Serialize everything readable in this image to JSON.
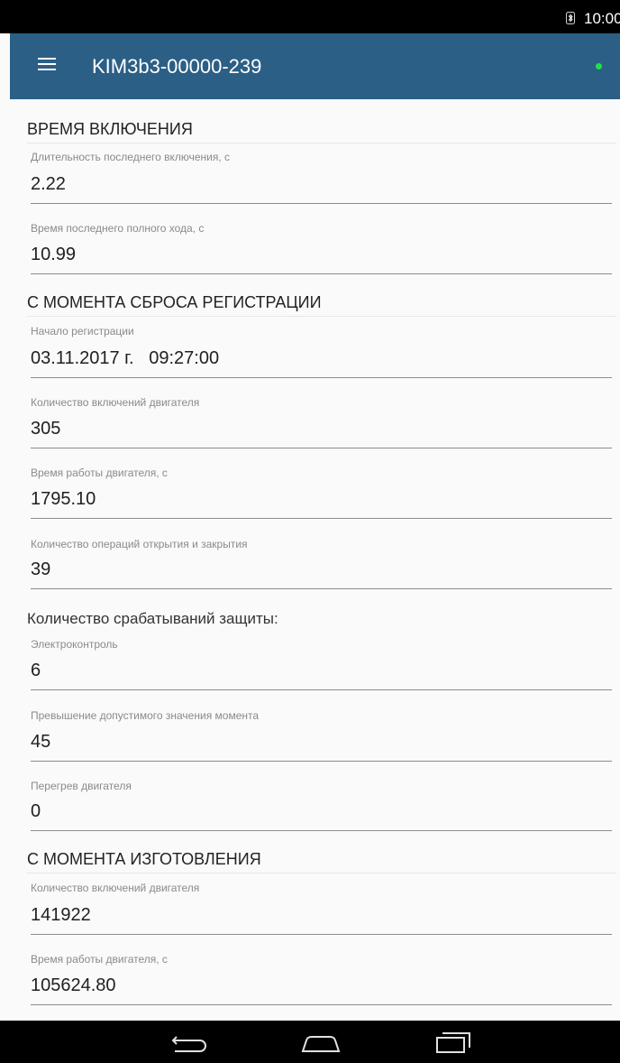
{
  "status_bar": {
    "time": "10:00",
    "bluetooth_icon": "bluetooth-icon"
  },
  "app_bar": {
    "menu_icon": "menu-icon",
    "title": "KIM3b3-00000-239",
    "status_indicator_color": "#22e04a"
  },
  "colors": {
    "app_bar": "#2b5f86",
    "background": "#fafafa"
  },
  "sections": {
    "power_on": {
      "title": "ВРЕМЯ ВКЛЮЧЕНИЯ",
      "fields": [
        {
          "label": "Длительность последнего включения, с",
          "value": "2.22"
        },
        {
          "label": "Время последнего полного хода, с",
          "value": "10.99"
        }
      ]
    },
    "since_reset": {
      "title": "С МОМЕНТА СБРОСА РЕГИСТРАЦИИ",
      "fields": [
        {
          "label": "Начало регистрации",
          "value": "03.11.2017 г.   09:27:00"
        },
        {
          "label": "Количество включений двигателя",
          "value": "305"
        },
        {
          "label": "Время работы двигателя, с",
          "value": "1795.10"
        },
        {
          "label": "Количество операций открытия и закрытия",
          "value": "39"
        }
      ],
      "protection_group_label": "Количество срабатываний защиты:",
      "protection_fields": [
        {
          "label": "Электроконтроль",
          "value": "6"
        },
        {
          "label": "Превышение допустимого значения момента",
          "value": "45"
        },
        {
          "label": "Перегрев двигателя",
          "value": "0"
        }
      ]
    },
    "since_manufacture": {
      "title": "С МОМЕНТА ИЗГОТОВЛЕНИЯ",
      "fields": [
        {
          "label": "Количество включений двигателя",
          "value": "141922"
        },
        {
          "label": "Время работы двигателя, с",
          "value": "105624.80"
        }
      ]
    }
  },
  "nav_bar": {
    "back_icon": "back-icon",
    "home_icon": "home-icon",
    "recents_icon": "recents-icon"
  }
}
